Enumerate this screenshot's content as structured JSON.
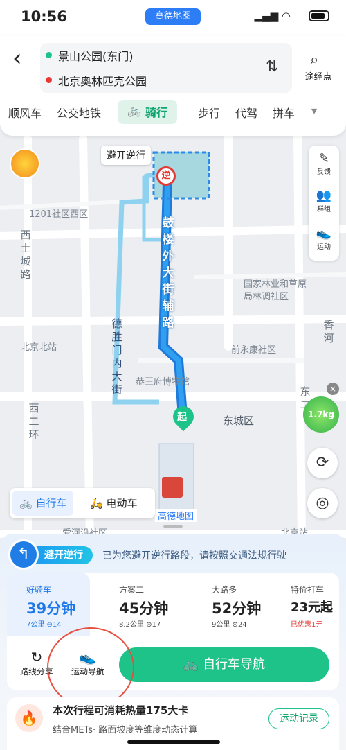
{
  "status": {
    "time": "10:56",
    "app": "高德地图"
  },
  "route": {
    "from": "景山公园(东门)",
    "to": "北京奥林匹克公园",
    "waypoint": "途经点"
  },
  "tabs": [
    "顺风车",
    "公交地铁",
    "骑行",
    "步行",
    "代驾",
    "拼车"
  ],
  "active_tab": "骑行",
  "map": {
    "avoid_label": "避开逆行",
    "reverse_marker": "逆",
    "start_marker": "起",
    "street_main": "鼓楼外大街辅路",
    "street_left": "德胜门内大街",
    "left_vert_1": "西土城路",
    "left_vert_2": "西二环",
    "right_vert_1": "香河",
    "right_vert_2": "东二",
    "labels": {
      "community": "1201社区西区",
      "forestry": "国家林业和草原局林调社区",
      "qianyongkang": "前永康社区",
      "bj_north": "北京北站",
      "prince": "恭王府博物馆",
      "dongcheng": "东城区",
      "aihe": "爱河沿社区",
      "bj_station": "北京站"
    },
    "co2": "1.7kg",
    "watermark": "高德地图"
  },
  "toolbar": {
    "feedback": "反馈",
    "group": "群组",
    "sport": "运动"
  },
  "vehicle": {
    "bike": "自行车",
    "ebike": "电动车"
  },
  "avoid": {
    "badge": "避开逆行",
    "text": "已为您避开逆行路段，请按照交通法规行驶"
  },
  "options": [
    {
      "name": "好骑车",
      "duration": "39分钟",
      "dist": "7公里",
      "lights": "14"
    },
    {
      "name": "方案二",
      "duration": "45分钟",
      "dist": "8.2公里",
      "lights": "17"
    },
    {
      "name": "大路多",
      "duration": "52分钟",
      "dist": "9公里",
      "lights": "24"
    },
    {
      "name": "特价打车",
      "price": "23元起",
      "note": "已优惠1元"
    }
  ],
  "actions": {
    "share": "路线分享",
    "sport_nav": "运动导航",
    "nav": "自行车导航"
  },
  "calorie": {
    "title": "本次行程可消耗热量175大卡",
    "sub": "结合METs· 路面坡度等维度动态计算",
    "btn": "运动记录"
  },
  "colors": {
    "accent": "#1ec38a",
    "route": "#2a8be8",
    "alt_route": "#7cc8ee"
  }
}
